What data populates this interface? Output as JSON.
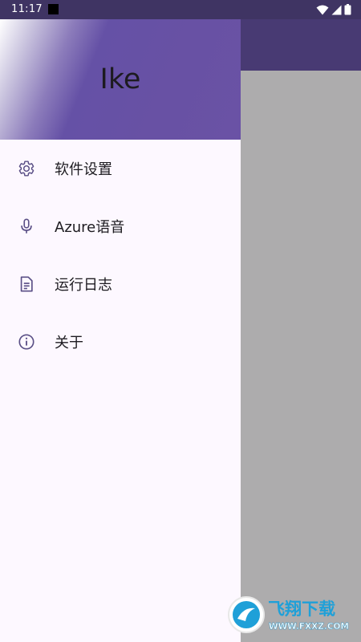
{
  "status_bar": {
    "time": "11:17",
    "icons": [
      "wifi-icon",
      "signal-icon",
      "battery-icon"
    ]
  },
  "drawer": {
    "header_title": "Ike",
    "items": [
      {
        "label": "软件设置",
        "icon": "gear-icon"
      },
      {
        "label": "Azure语音",
        "icon": "microphone-icon"
      },
      {
        "label": "运行日志",
        "icon": "document-icon"
      },
      {
        "label": "关于",
        "icon": "info-icon"
      }
    ]
  },
  "watermark": {
    "brand": "飞翔下载",
    "url": "WWW.FXXZ.COM"
  },
  "colors": {
    "accent": "#6750a4",
    "app_bar": "#483a73",
    "status_bar": "#3f3463",
    "scrim": "#adacad",
    "drawer_bg": "#fdf8ff",
    "icon": "#5a4f86"
  }
}
